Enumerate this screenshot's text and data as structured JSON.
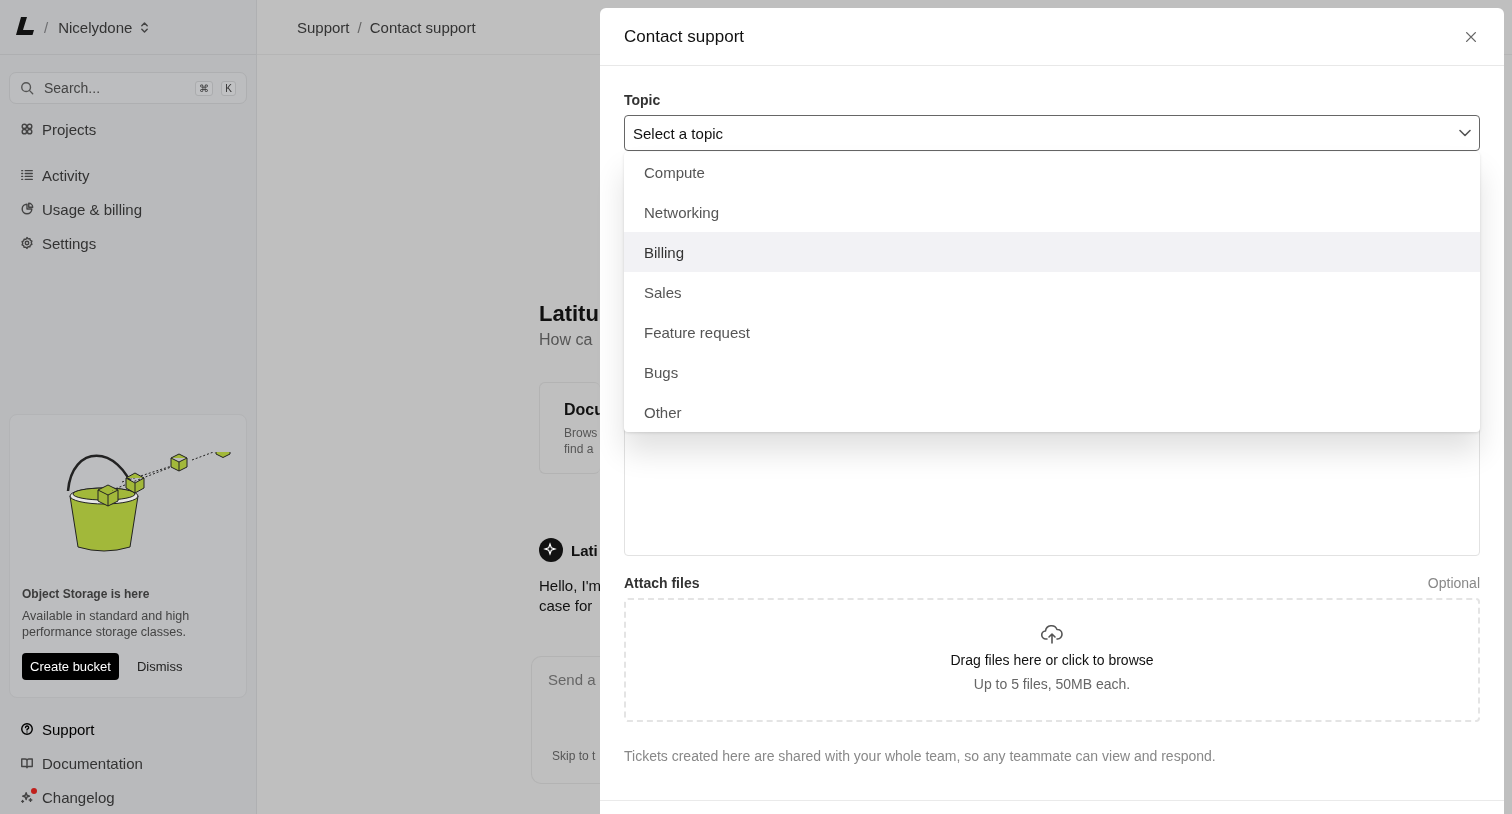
{
  "workspace": {
    "separator": "/",
    "name": "Nicelydone"
  },
  "search": {
    "placeholder": "Search...",
    "keys": [
      "⌘",
      "K"
    ]
  },
  "sidebar": {
    "items": [
      {
        "label": "Projects",
        "selected": false
      },
      {
        "label": "Activity",
        "selected": false
      },
      {
        "label": "Usage & billing",
        "selected": false
      },
      {
        "label": "Settings",
        "selected": false
      }
    ],
    "promo": {
      "title": "Object Storage is here",
      "text": "Available in standard and high performance storage classes.",
      "buttons": [
        "Create bucket",
        "Dismiss"
      ]
    },
    "bottom_items": [
      {
        "label": "Support",
        "selected": true,
        "badge": false
      },
      {
        "label": "Documentation",
        "selected": false,
        "badge": false
      },
      {
        "label": "Changelog",
        "selected": false,
        "badge": true
      }
    ]
  },
  "breadcrumb": {
    "separator": "/",
    "items": [
      "Support",
      "Contact support"
    ]
  },
  "main": {
    "title": "Latitu",
    "subtitle": "How ca",
    "card": {
      "title": "Docu",
      "lines": [
        "Brows",
        "find a"
      ]
    },
    "assistant": {
      "name": "Lati",
      "message": [
        "Hello, I'm",
        "case for"
      ]
    },
    "composer": {
      "placeholder": "Send a",
      "link": "Skip to t"
    }
  },
  "dialog": {
    "title": "Contact support",
    "topic": {
      "label": "Topic",
      "placeholder": "Select a topic",
      "expanded": true,
      "options": [
        {
          "label": "Compute",
          "selected": false
        },
        {
          "label": "Networking",
          "selected": false
        },
        {
          "label": "Billing",
          "selected": true
        },
        {
          "label": "Sales",
          "selected": false
        },
        {
          "label": "Feature request",
          "selected": false
        },
        {
          "label": "Bugs",
          "selected": false
        },
        {
          "label": "Other",
          "selected": false
        }
      ]
    },
    "attach": {
      "label": "Attach files",
      "hint": "Optional",
      "drop_title": "Drag files here or click to browse",
      "drop_sub": "Up to 5 files, 50MB each."
    },
    "note": "Tickets created here are shared with your whole team, so any teammate can view and respond."
  }
}
